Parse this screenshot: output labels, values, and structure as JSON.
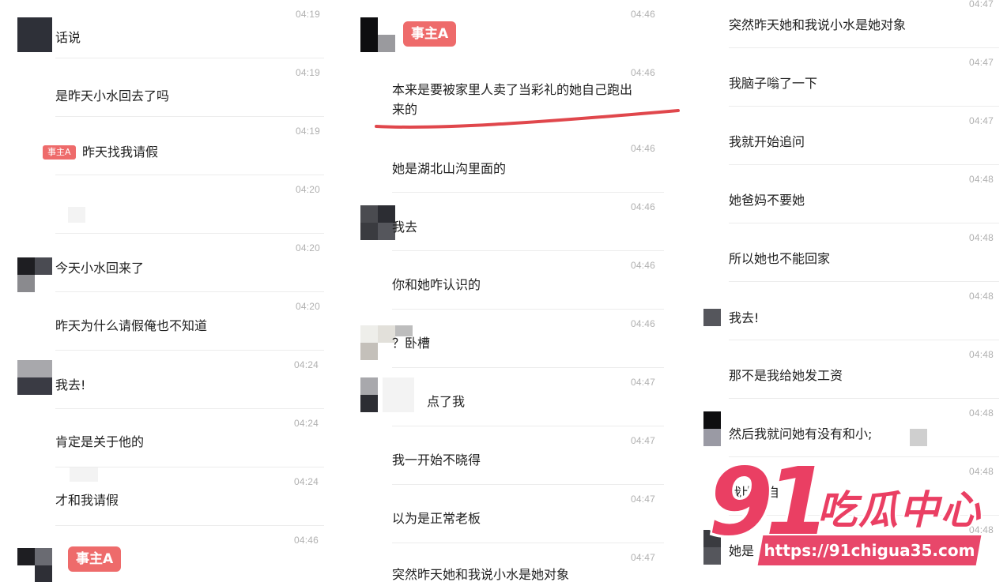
{
  "panels": [
    {
      "messages": [
        {
          "time": "04:19",
          "text": "话说"
        },
        {
          "time": "04:19",
          "text": "是昨天小水回去了吗"
        },
        {
          "time": "04:19",
          "text": "昨天找我请假",
          "tag": "事主A"
        },
        {
          "time": "04:20",
          "text": ""
        },
        {
          "time": "04:20",
          "text": "今天小水回来了"
        },
        {
          "time": "04:20",
          "text": "昨天为什么请假俺也不知道"
        },
        {
          "time": "04:24",
          "text": "我去!"
        },
        {
          "time": "04:24",
          "text": "肯定是关于他的"
        },
        {
          "time": "04:24",
          "text": "才和我请假"
        },
        {
          "time": "04:46",
          "text": "",
          "tag": "事主A"
        }
      ]
    },
    {
      "messages": [
        {
          "time": "04:46",
          "text": "",
          "tag": "事主A"
        },
        {
          "time": "04:46",
          "text": "本来是要被家里人卖了当彩礼的她自己跑出来的",
          "line1": "本来是要被家里人卖了当彩礼的她自己跑出",
          "line2": "来的"
        },
        {
          "time": "04:46",
          "text": "她是湖北山沟里面的"
        },
        {
          "time": "04:46",
          "text": "我去"
        },
        {
          "time": "04:46",
          "text": "你和她咋认识的"
        },
        {
          "time": "04:46",
          "text": "？卧槽"
        },
        {
          "time": "04:47",
          "text": "点了我"
        },
        {
          "time": "04:47",
          "text": "我一开始不晓得"
        },
        {
          "time": "04:47",
          "text": "以为是正常老板"
        },
        {
          "time": "04:47",
          "text": "突然昨天她和我说小水是她对象"
        }
      ]
    },
    {
      "messages": [
        {
          "time": "04:47",
          "text": "突然昨天她和我说小水是她对象"
        },
        {
          "time": "04:47",
          "text": "我脑子嗡了一下"
        },
        {
          "time": "04:47",
          "text": "我就开始追问"
        },
        {
          "time": "04:48",
          "text": "她爸妈不要她"
        },
        {
          "time": "04:48",
          "text": "所以她也不能回家"
        },
        {
          "time": "04:48",
          "text": "我去!"
        },
        {
          "time": "04:48",
          "text": "那不是我给她发工资"
        },
        {
          "time": "04:48",
          "text": "然后我就问她有没有和小;"
        },
        {
          "time": "04:48",
          "text": "我比较自"
        },
        {
          "time": "04:48",
          "text": "她是"
        }
      ]
    }
  ],
  "watermark": {
    "number": "91",
    "title": "吃瓜中心",
    "url": "https://91chigua35.com"
  },
  "colors": {
    "tag": "#ee6b6b",
    "underline": "#e0474c",
    "watermark": "#ea3f63",
    "time": "#b0b0b0",
    "divider": "#ececec"
  }
}
